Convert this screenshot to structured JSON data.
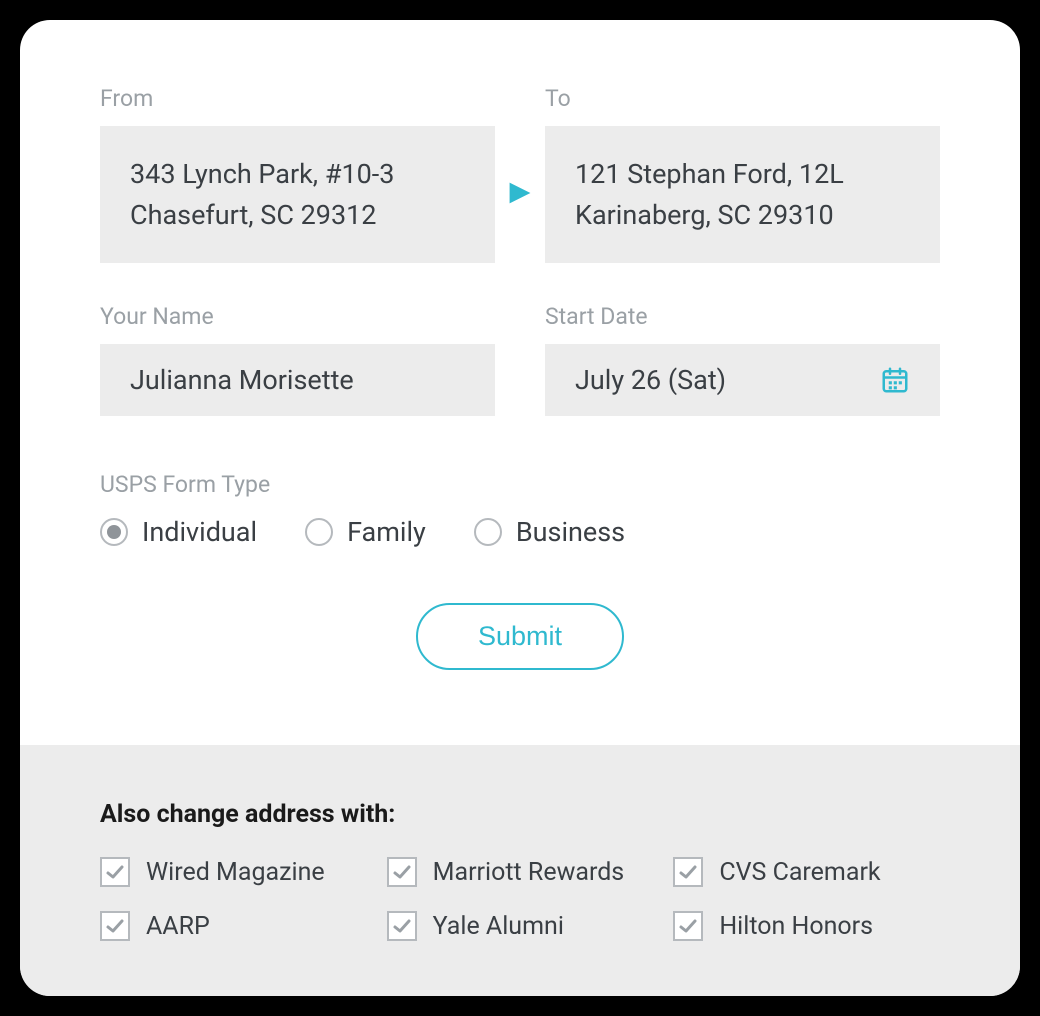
{
  "from": {
    "label": "From",
    "line1": "343 Lynch Park, #10-3",
    "line2": "Chasefurt, SC 29312"
  },
  "to": {
    "label": "To",
    "line1": "121 Stephan Ford, 12L",
    "line2": "Karinaberg, SC 29310"
  },
  "name": {
    "label": "Your Name",
    "value": "Julianna Morisette"
  },
  "start_date": {
    "label": "Start Date",
    "value": "July 26 (Sat)"
  },
  "form_type": {
    "label": "USPS Form Type",
    "options": [
      "Individual",
      "Family",
      "Business"
    ],
    "selected": "Individual"
  },
  "submit_label": "Submit",
  "partners": {
    "title": "Also change address with:",
    "items": [
      {
        "label": "Wired Magazine",
        "checked": true
      },
      {
        "label": "Marriott Rewards",
        "checked": true
      },
      {
        "label": "CVS Caremark",
        "checked": true
      },
      {
        "label": "AARP",
        "checked": true
      },
      {
        "label": "Yale Alumni",
        "checked": true
      },
      {
        "label": "Hilton Honors",
        "checked": true
      }
    ]
  },
  "colors": {
    "accent": "#2fb9cf"
  }
}
